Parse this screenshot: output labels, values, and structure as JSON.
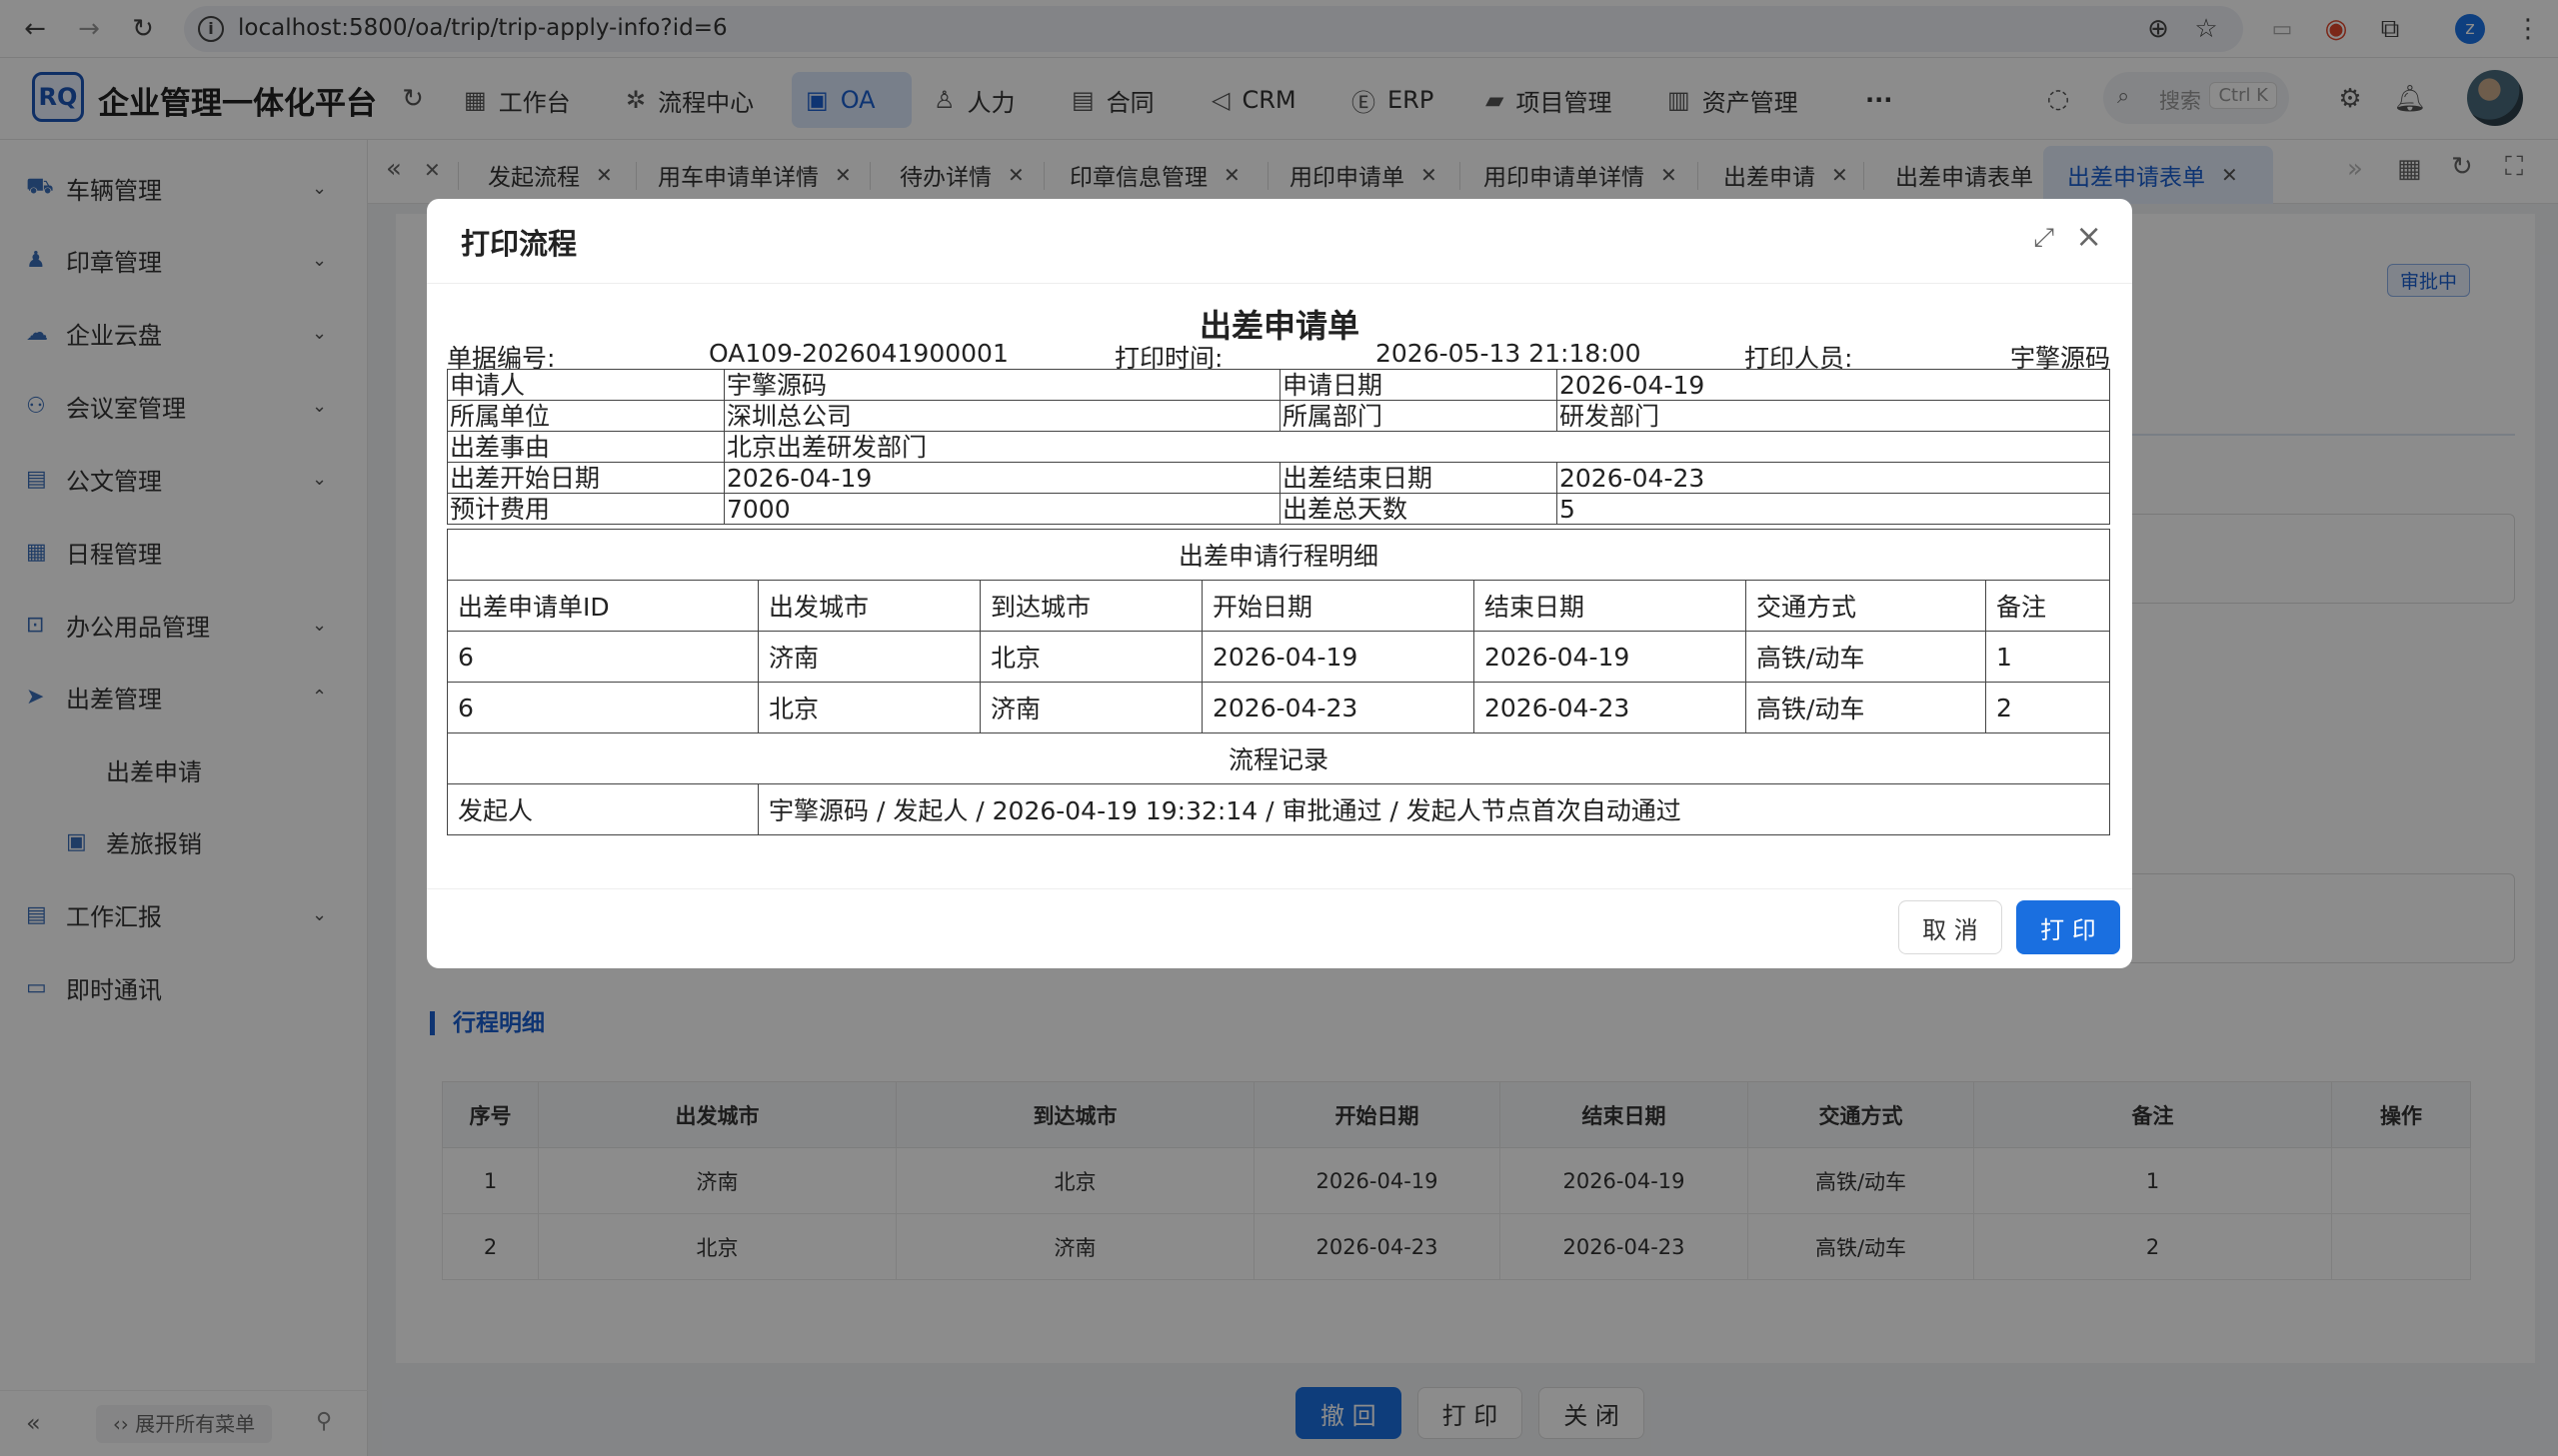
{
  "browser": {
    "url": "localhost:5800/oa/trip/trip-apply-info?id=6",
    "profile_letter": "z"
  },
  "app": {
    "logo_text": "RQ",
    "title": "企业管理一体化平台",
    "nav": [
      {
        "label": "工作台",
        "icon": "dashboard-icon"
      },
      {
        "label": "流程中心",
        "icon": "workflow-icon"
      },
      {
        "label": "OA",
        "icon": "oa-icon"
      },
      {
        "label": "人力",
        "icon": "people-icon"
      },
      {
        "label": "合同",
        "icon": "contract-icon"
      },
      {
        "label": "CRM",
        "icon": "crm-icon"
      },
      {
        "label": "ERP",
        "icon": "erp-icon"
      },
      {
        "label": "项目管理",
        "icon": "project-icon"
      },
      {
        "label": "资产管理",
        "icon": "asset-icon"
      }
    ],
    "more": "···",
    "search_placeholder": "搜索",
    "search_shortcut": "Ctrl K"
  },
  "sidebar": {
    "items": [
      {
        "label": "车辆管理"
      },
      {
        "label": "印章管理"
      },
      {
        "label": "企业云盘"
      },
      {
        "label": "会议室管理"
      },
      {
        "label": "公文管理"
      },
      {
        "label": "日程管理"
      },
      {
        "label": "办公用品管理"
      },
      {
        "label": "出差管理"
      },
      {
        "label": "出差申请"
      },
      {
        "label": "差旅报销"
      },
      {
        "label": "工作汇报"
      },
      {
        "label": "即时通讯"
      }
    ],
    "expand_all": "展开所有菜单"
  },
  "tabs": [
    "发起流程",
    "用车申请单详情",
    "待办详情",
    "印章信息管理",
    "用印申请单",
    "用印申请单详情",
    "出差申请",
    "出差申请表单",
    "出差申请表单"
  ],
  "page": {
    "status": "审批中",
    "section_title": "行程明细",
    "table_headers": [
      "序号",
      "出发城市",
      "到达城市",
      "开始日期",
      "结束日期",
      "交通方式",
      "备注",
      "操作"
    ],
    "table_rows": [
      [
        "1",
        "济南",
        "北京",
        "2026-04-19",
        "2026-04-19",
        "高铁/动车",
        "1",
        ""
      ],
      [
        "2",
        "北京",
        "济南",
        "2026-04-23",
        "2026-04-23",
        "高铁/动车",
        "2",
        ""
      ]
    ],
    "buttons": {
      "revoke": "撤 回",
      "print": "打 印",
      "close": "关 闭"
    }
  },
  "modal": {
    "title": "打印流程",
    "doc_title": "出差申请单",
    "doc_no_label": "单据编号:",
    "doc_no": "OA109-2026041900001",
    "print_time_label": "打印时间:",
    "print_time": "2026-05-13 21:18:00",
    "printer_label": "打印人员:",
    "printer": "宇擎源码",
    "fields": {
      "applicant_label": "申请人",
      "applicant": "宇擎源码",
      "apply_date_label": "申请日期",
      "apply_date": "2026-04-19",
      "unit_label": "所属单位",
      "unit": "深圳总公司",
      "dept_label": "所属部门",
      "dept": "研发部门",
      "reason_label": "出差事由",
      "reason": "北京出差研发部门",
      "start_label": "出差开始日期",
      "start": "2026-04-19",
      "end_label": "出差结束日期",
      "end": "2026-04-23",
      "cost_label": "预计费用",
      "cost": "7000",
      "days_label": "出差总天数",
      "days": "5"
    },
    "detail_caption": "出差申请行程明细",
    "detail_headers": [
      "出差申请单ID",
      "出发城市",
      "到达城市",
      "开始日期",
      "结束日期",
      "交通方式",
      "备注"
    ],
    "detail_rows": [
      [
        "6",
        "济南",
        "北京",
        "2026-04-19",
        "2026-04-19",
        "高铁/动车",
        "1"
      ],
      [
        "6",
        "北京",
        "济南",
        "2026-04-23",
        "2026-04-23",
        "高铁/动车",
        "2"
      ]
    ],
    "flow_caption": "流程记录",
    "flow_label": "发起人",
    "flow_text": "宇擎源码 / 发起人 / 2026-04-19 19:32:14 / 审批通过 / 发起人节点首次自动通过",
    "cancel": "取 消",
    "print": "打 印"
  }
}
